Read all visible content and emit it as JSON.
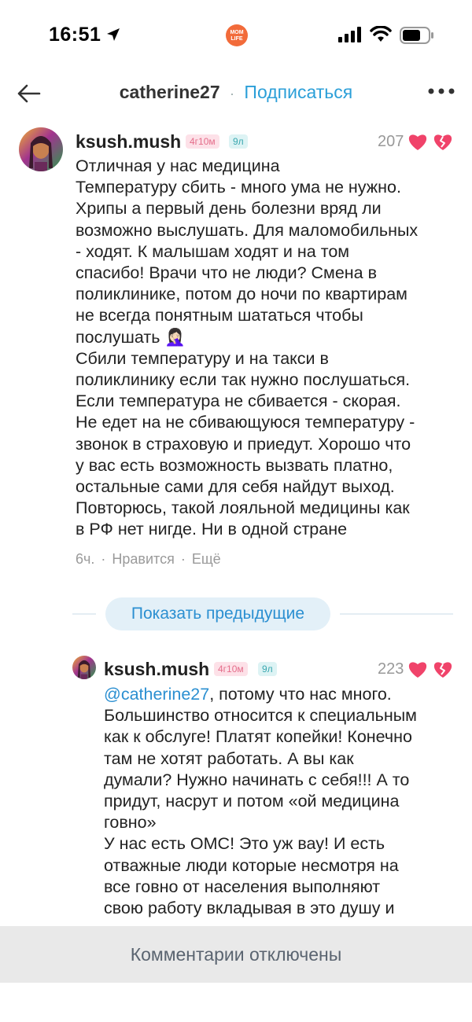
{
  "status_bar": {
    "time": "16:51",
    "app_logo_text": "MOM LIFE"
  },
  "header": {
    "username": "catherine27",
    "separator": "·",
    "subscribe": "Подписаться"
  },
  "comments": [
    {
      "username": "ksush.mush",
      "age_badge": "4г10м",
      "kid_badge": "9л",
      "likes": "207",
      "text": "Отличная у нас медицина\nТемпературу сбить - много ума не нужно.\nХрипы а первый день болезни вряд ли\nвозможно выслушать. Для маломобильных\n- ходят. К малышам ходят и на том\nспасибо! Врачи что не люди? Смена в\nполиклинике, потом до ночи по квартирам\nне всегда понятным шататься чтобы\nпослушать 🤦🏻‍♀️\nСбили температуру и на такси в\nполиклинику если так нужно послушаться.\nЕсли температура не сбивается - скорая.\nНе едет на не сбивающуюся температуру -\nзвонок в страховую и приедут. Хорошо что\nу вас есть возможность вызвать платно,\nостальные сами для себя найдут выход.\nПовторюсь, такой лояльной медицины как\nв РФ нет нигде. Ни в одной стране",
      "time": "6ч.",
      "like_action": "Нравится",
      "more_action": "Ещё"
    },
    {
      "username": "ksush.mush",
      "age_badge": "4г10м",
      "kid_badge": "9л",
      "likes": "223",
      "mention": "@catherine27",
      "text": ", потому что нас много.\nБольшинство относится к специальным\nкак к обслуге! Платят копейки! Конечно\nтам не хотят работать. А вы как\nдумали? Нужно начинать с себя!!! А то\nпридут, насрут и потом «ой медицина\nговно»\nУ нас есть ОМС! Это уж вау! И есть\nотважные люди которые несмотря на\nвсе говно от населения выполняют\nсвою работу вкладывая в это душу и"
    }
  ],
  "show_previous": "Показать предыдущие",
  "footer": {
    "comments_disabled": "Комментарии отключены"
  },
  "colors": {
    "accent": "#2b8fd1",
    "heart": "#f0436a",
    "age_badge_bg": "#fde1e8",
    "kid_badge_bg": "#ddf3f4",
    "footer_bg": "#e9e9e9"
  }
}
